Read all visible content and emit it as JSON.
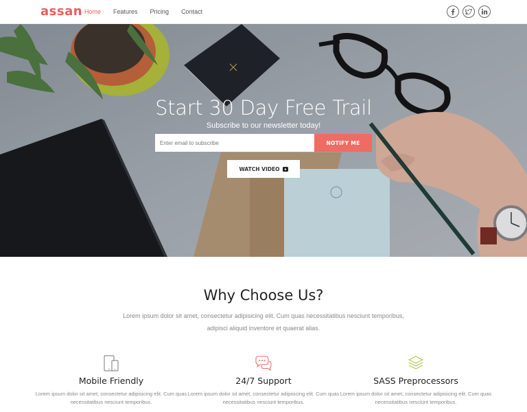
{
  "nav": {
    "logo": "assan",
    "links": [
      "Home",
      "Features",
      "Pricing",
      "Contact"
    ],
    "social_icons": [
      "facebook-icon",
      "twitter-icon",
      "linkedin-icon"
    ]
  },
  "hero": {
    "title": "Start 30 Day Free Trail",
    "subtitle": "Subscribe to our newsletter today!",
    "email_placeholder": "Enter email to subscribe",
    "notify_label": "NOTIFY ME",
    "watch_label": "WATCH VIDEO"
  },
  "why": {
    "title": "Why Choose Us?",
    "description": "Lorem ipsum dolor sit amet, consectetur adipisicing elit. Cum quas necessitatibus nesciunt temporibus, adipisci aliquid inventore et quaerat alias."
  },
  "features": [
    {
      "icon": "tablet-icon",
      "title": "Mobile Friendly",
      "text": "Lorem ipsum dolor sit amet, consectetur adipisicing elit. Cum quas necessitatibus nesciunt temporibus."
    },
    {
      "icon": "chat-icon",
      "title": "24/7 Support",
      "text": "Lorem ipsum dolor sit amet, consectetur adipisicing elit. Cum quas necessitatibus nesciunt temporibus."
    },
    {
      "icon": "layers-icon",
      "title": "SASS Preprocessors",
      "text": "Lorem ipsum dolor sit amet, consectetur adipisicing elit. Cum quas necessitatibus nesciunt temporibus."
    }
  ],
  "colors": {
    "accent": "#ef5a5a",
    "notify_button": "#ef6b63",
    "icon_grey": "#777777",
    "icon_red": "#ef6b63",
    "icon_green": "#a6c43c"
  }
}
